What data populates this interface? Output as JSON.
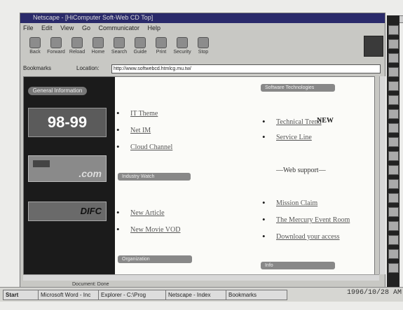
{
  "window": {
    "title": "Netscape - [HiComputer Soft-Web CD Top]"
  },
  "menu": [
    "File",
    "Edit",
    "View",
    "Go",
    "Communicator",
    "Help"
  ],
  "toolbar": [
    "Back",
    "Forward",
    "Reload",
    "Home",
    "Search",
    "Guide",
    "Print",
    "Security",
    "Stop"
  ],
  "bookmarks": {
    "label": "Bookmarks",
    "location_label": "Location:",
    "url": "http://www.softwebcd.htmlcg.mu.tw/"
  },
  "sidebar": {
    "top_button": "General Information",
    "banner1": "98-99",
    "banner2": ".com",
    "banner3": "DIFC"
  },
  "headers": {
    "right_top": "Software Technologies",
    "left_mid": "Industry Watch",
    "left_bottom": "Organization",
    "right_bottom": "Info"
  },
  "left_links_top": [
    "IT Theme",
    "Net IM",
    "Cloud Channel"
  ],
  "left_links_bottom": [
    "New Article",
    "New Movie VOD"
  ],
  "right_links_top": [
    "Technical Trend",
    "Service Line"
  ],
  "right_top_marker": "NEW",
  "right_note": "—Web support—",
  "right_links_bottom": [
    "Mission Claim",
    "The Mercury Event Room",
    "Download your access"
  ],
  "status": {
    "text": "Document: Done"
  },
  "taskbar": {
    "start": "Start",
    "items": [
      "Microsoft Word - Inc",
      "Explorer - C:\\Prog",
      "Netscape - Index",
      "Bookmarks"
    ],
    "clock": "1996/10/28 AM"
  }
}
